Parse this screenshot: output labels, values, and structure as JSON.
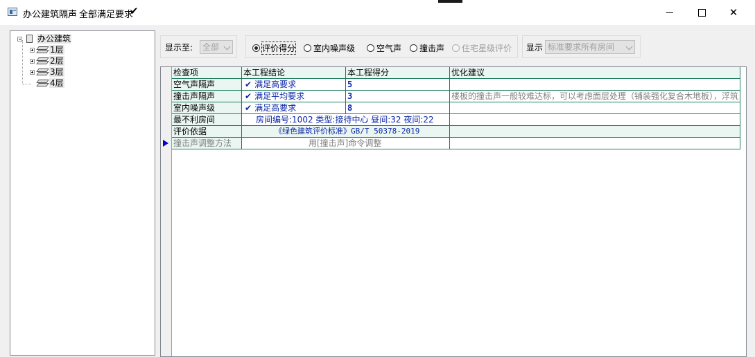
{
  "window": {
    "title": "办公建筑隔声",
    "status": "全部满足要求",
    "status_check": "✔",
    "close_glyph": "✕"
  },
  "tree": {
    "root": "办公建筑",
    "floors": [
      "1层",
      "2层",
      "3层",
      "4层"
    ]
  },
  "toolbar": {
    "display_to_label": "显示至:",
    "display_to_value": "全部",
    "radios": [
      {
        "label": "评价得分",
        "checked": true,
        "enabled": true
      },
      {
        "label": "室内噪声级",
        "checked": false,
        "enabled": true
      },
      {
        "label": "空气声",
        "checked": false,
        "enabled": true
      },
      {
        "label": "撞击声",
        "checked": false,
        "enabled": true
      },
      {
        "label": "住宅星级评价",
        "checked": false,
        "enabled": false
      }
    ],
    "show_label": "显示",
    "show_value": "标准要求所有房间"
  },
  "grid": {
    "columns": [
      "检查项",
      "本工程结论",
      "本工程得分",
      "优化建议"
    ],
    "rows": [
      {
        "item": "空气声隔声",
        "check": "✔",
        "conclusion": "满足高要求",
        "score": "5",
        "advice": ""
      },
      {
        "item": "撞击声隔声",
        "check": "✔",
        "conclusion": "满足平均要求",
        "score": "3",
        "advice": "楼板的撞击声一般较难达标，可以考虑面层处理（铺装强化复合木地板），浮筑"
      },
      {
        "item": "室内噪声级",
        "check": "✔",
        "conclusion": "满足高要求",
        "score": "8",
        "advice": ""
      },
      {
        "item": "最不利房间",
        "span_text": "房间编号:1002 类型:接待中心 昼间:32 夜间:22"
      },
      {
        "item": "评价依据",
        "span_text": "《绿色建筑评价标准》GB/T 50378-2019"
      },
      {
        "item": "撞击声调整方法",
        "span_text": "用[撞击声]命令调整"
      }
    ]
  }
}
